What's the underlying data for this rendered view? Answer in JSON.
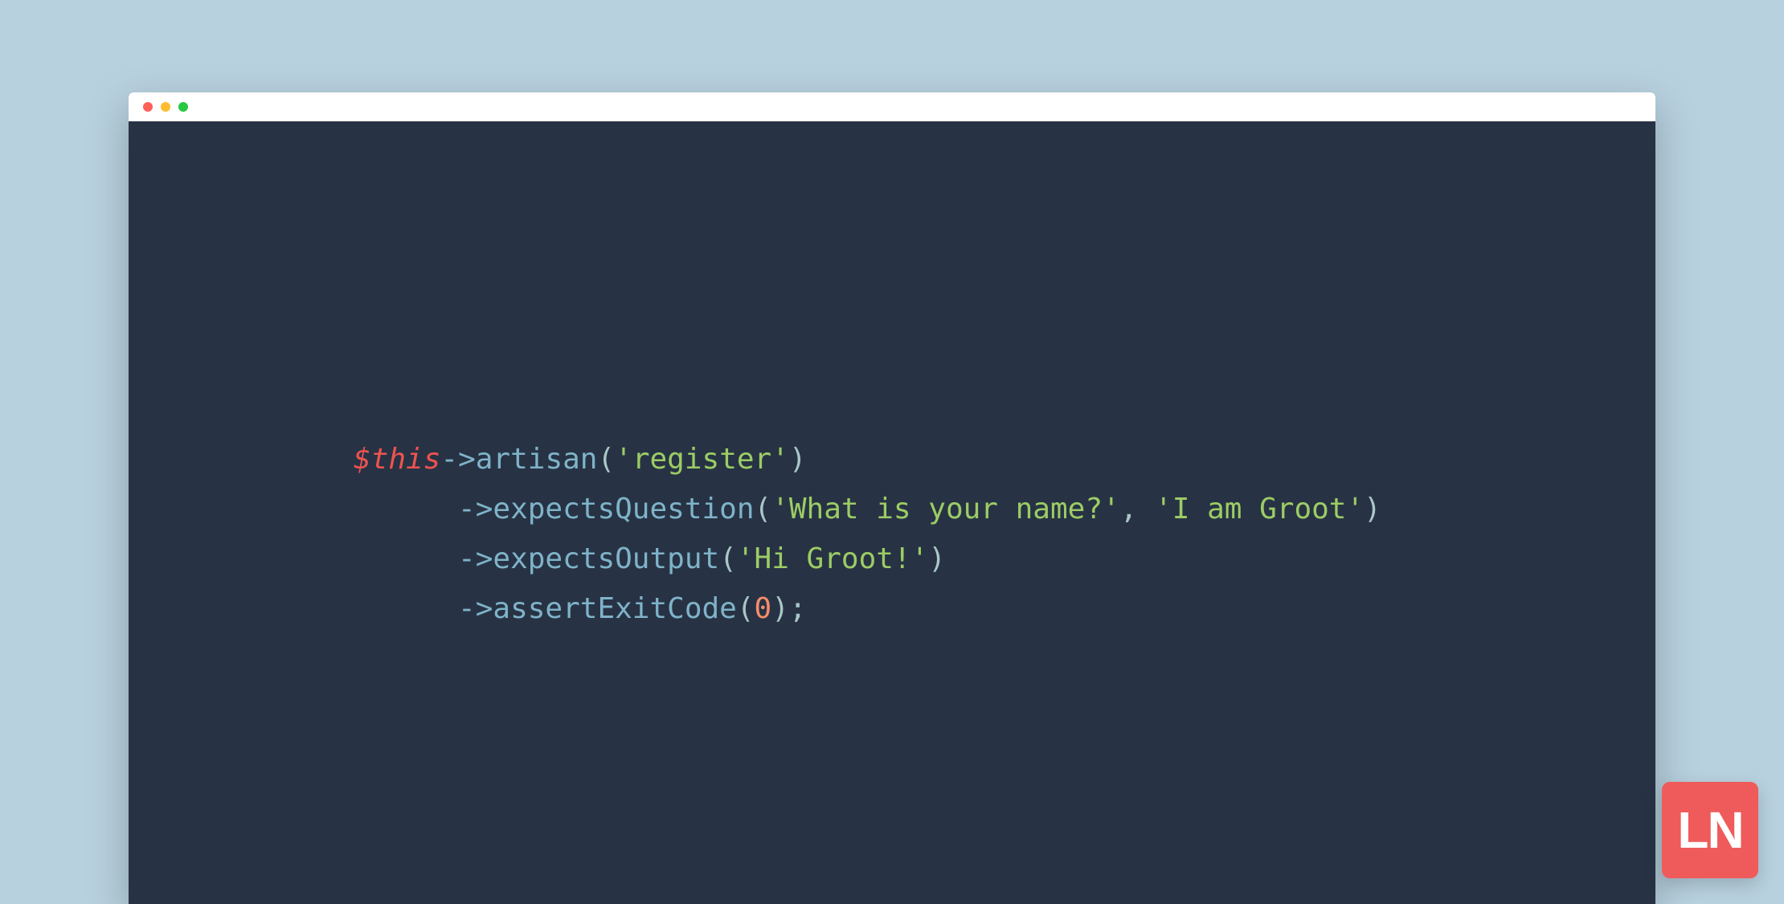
{
  "colors": {
    "page_bg": "#b8d1df",
    "editor_bg": "#273344",
    "titlebar_bg": "#ffffff",
    "dot_red": "#ff5f57",
    "dot_yellow": "#febc2e",
    "dot_green": "#28c840",
    "logo_bg": "#ef5b5b",
    "tok_var": "#ef5350",
    "tok_method": "#7fb3c9",
    "tok_string": "#9ccc65",
    "tok_number": "#f78c6c"
  },
  "logo": {
    "text": "LN"
  },
  "code": {
    "line1": {
      "dollar": "$",
      "this_kw": "this",
      "arrow": "->",
      "method": "artisan",
      "open": "(",
      "arg": "'register'",
      "close": ")"
    },
    "line2": {
      "indent": "      ",
      "arrow": "->",
      "method": "expectsQuestion",
      "open": "(",
      "arg1": "'What is your name?'",
      "comma": ", ",
      "arg2": "'I am Groot'",
      "close": ")"
    },
    "line3": {
      "indent": "      ",
      "arrow": "->",
      "method": "expectsOutput",
      "open": "(",
      "arg": "'Hi Groot!'",
      "close": ")"
    },
    "line4": {
      "indent": "      ",
      "arrow": "->",
      "method": "assertExitCode",
      "open": "(",
      "arg": "0",
      "close": ")",
      "semi": ";"
    }
  }
}
